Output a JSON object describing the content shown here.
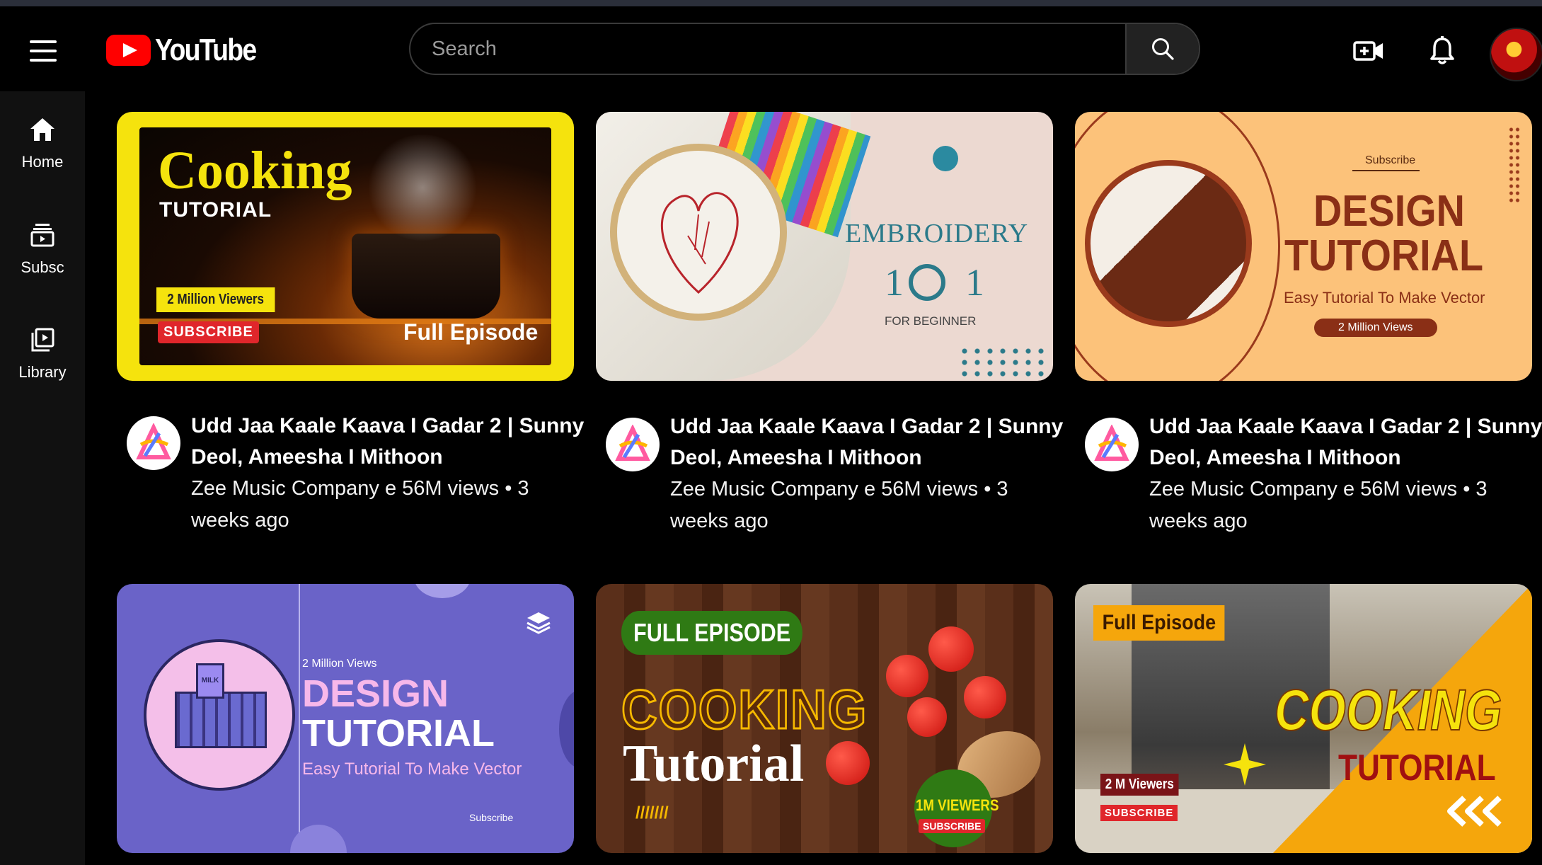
{
  "header": {
    "logo_text": "YouTube",
    "search_placeholder": "Search"
  },
  "sidebar": {
    "items": [
      {
        "label": "Home",
        "icon": "home-icon"
      },
      {
        "label": "Subsc",
        "icon": "subscriptions-icon"
      },
      {
        "label": "Library",
        "icon": "library-icon"
      }
    ]
  },
  "videos": [
    {
      "title": "Udd Jaa Kaale Kaava I Gadar 2 | Sunny Deol, Ameesha I Mithoon",
      "channel_line": "Zee Music Company e 56M views • 3 weeks ago",
      "thumb": {
        "t1": "Cooking",
        "t2": "TUTORIAL",
        "t3": "2 Million Viewers",
        "t4": "SUBSCRIBE",
        "t5": "Full Episode"
      }
    },
    {
      "title": "Udd Jaa Kaale Kaava I Gadar 2 | Sunny Deol, Ameesha I Mithoon",
      "channel_line": "Zee Music Company e 56M views • 3 weeks ago",
      "thumb": {
        "t1": "EMBROIDERY",
        "t2": "1",
        "t3": "1",
        "t4": "FOR BEGINNER"
      }
    },
    {
      "title": "Udd Jaa Kaale Kaava I Gadar 2 | Sunny Deol, Ameesha I Mithoon",
      "channel_line": "Zee Music Company e 56M views • 3 weeks ago",
      "thumb": {
        "t1": "Subscribe",
        "t2": "DESIGN",
        "t3": "TUTORIAL",
        "t4": "Easy Tutorial To Make Vector",
        "t5": "2 Million Views"
      }
    },
    {
      "title": "",
      "channel_line": "",
      "thumb": {
        "t1": "2 Million Views",
        "t2": "DESIGN",
        "t3": "TUTORIAL",
        "t4": "Easy Tutorial To Make Vector",
        "t5": "Subscribe",
        "t6": "MILK"
      }
    },
    {
      "title": "",
      "channel_line": "",
      "thumb": {
        "t1": "FULL EPISODE",
        "t2": "COOKING",
        "t3": "Tutorial",
        "t4": "1M VIEWERS",
        "t5": "SUBSCRIBE",
        "t6": "///////"
      }
    },
    {
      "title": "",
      "channel_line": "",
      "thumb": {
        "t1": "Full Episode",
        "t2": "COOKING",
        "t3": "TUTORIAL",
        "t4": "2 M Viewers",
        "t5": "SUBSCRIBE"
      }
    }
  ]
}
